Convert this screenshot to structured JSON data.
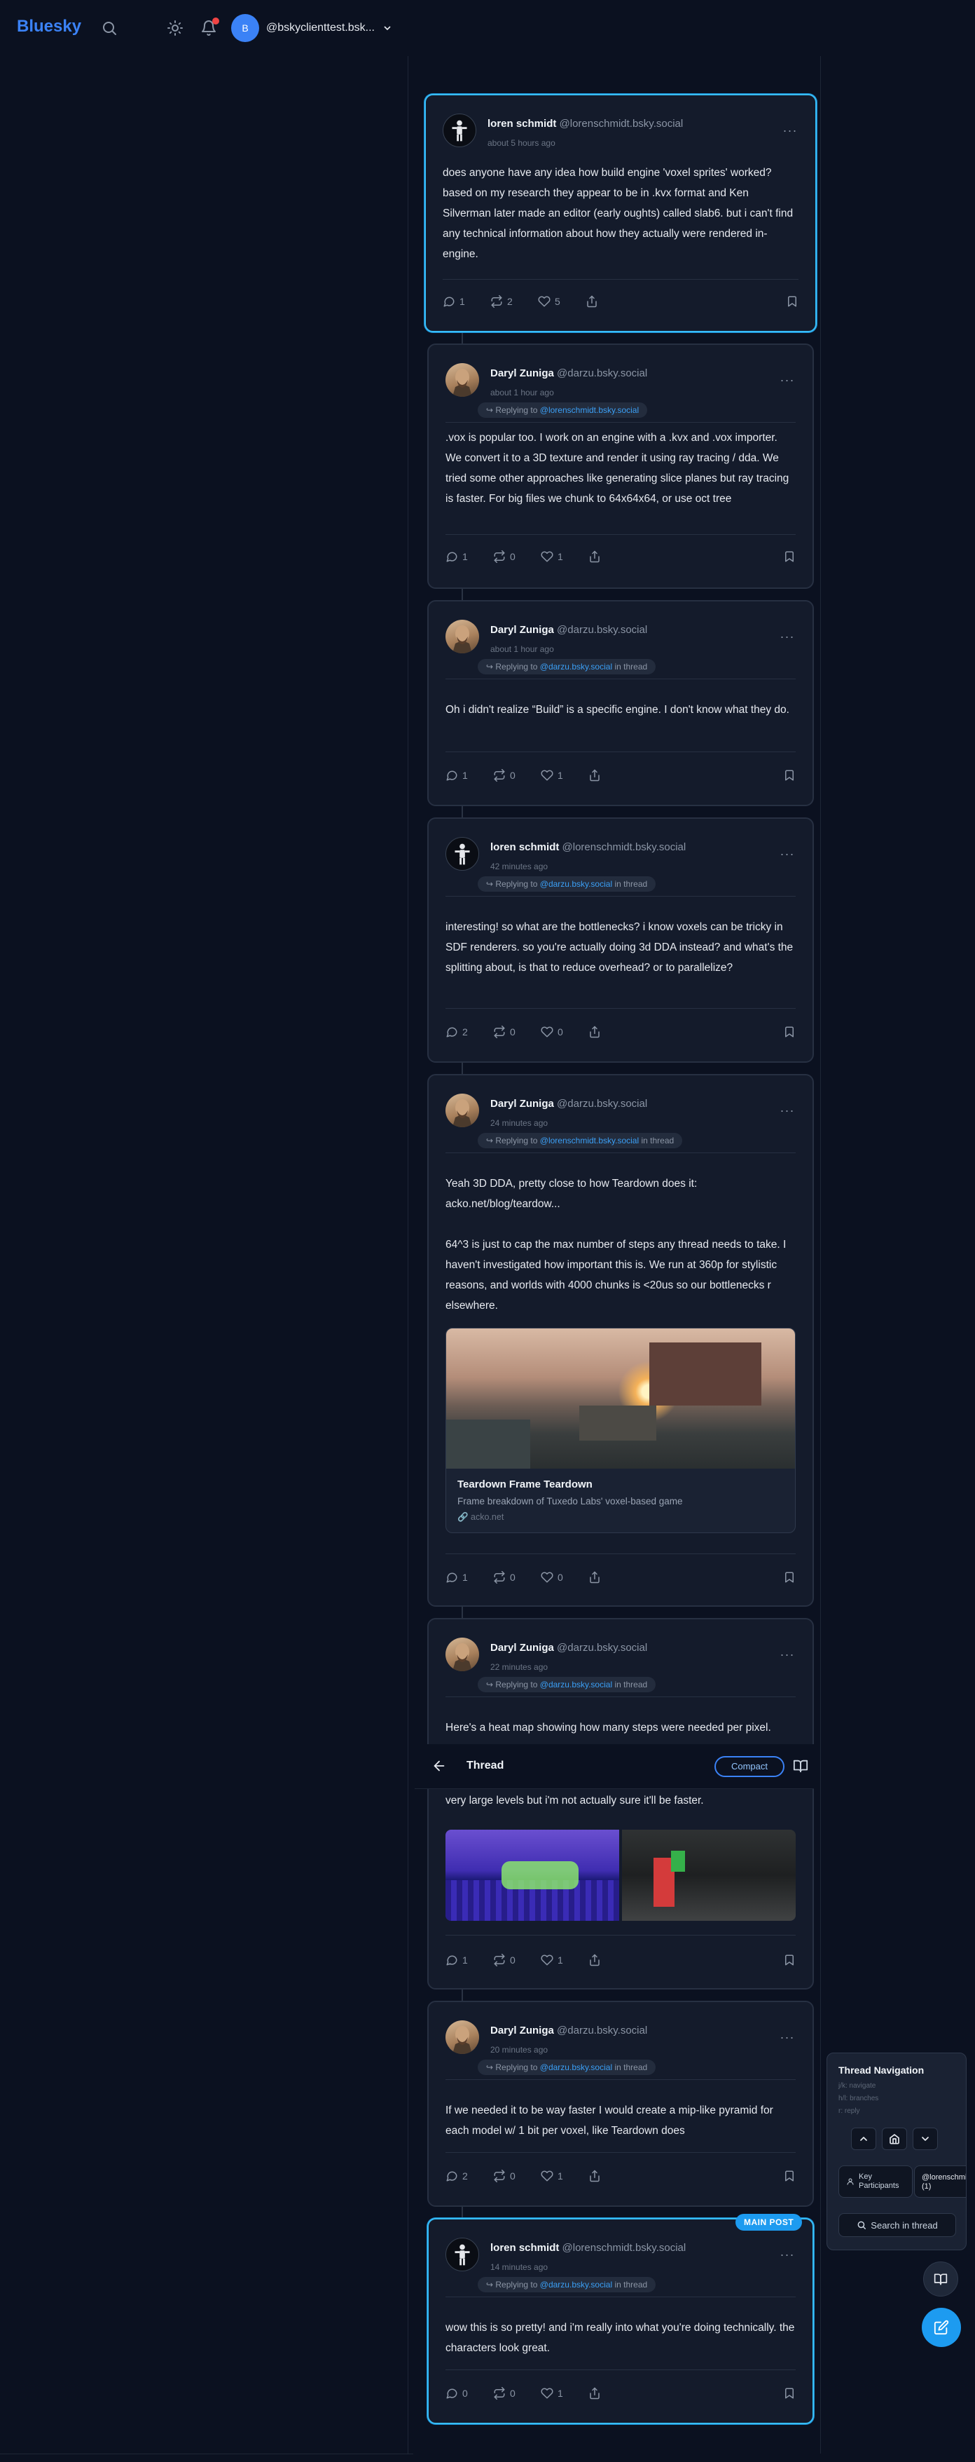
{
  "header": {
    "logo": "Bluesky",
    "account_avatar_letter": "B",
    "account_name": "@bskyclienttest.bsk..."
  },
  "thread_bar": {
    "title": "Thread",
    "compact_label": "Compact"
  },
  "posts": [
    {
      "author": "loren schmidt",
      "handle": "@lorenschmidt.bsky.social",
      "time": "about 5 hours ago",
      "body": [
        "does anyone have any idea how build engine 'voxel sprites' worked? based on my research they appear to be in .kvx format and Ken Silverman later made an editor (early oughts) called slab6. but i can't find any technical information about how they actually were rendered in-engine."
      ],
      "replies": "1",
      "reposts": "2",
      "likes": "5"
    },
    {
      "author": "Daryl Zuniga",
      "handle": "@darzu.bsky.social",
      "time": "about 1 hour ago",
      "replying_prefix": "Replying to",
      "replying_to": "@lorenschmidt.bsky.social",
      "replying_suffix": "",
      "body": [
        ".vox is popular too. I work on an engine with a .kvx and .vox importer. We convert it to a 3D texture and render it using ray tracing / dda. We tried some other approaches like generating slice planes but ray tracing is faster. For big files we chunk to 64x64x64, or use oct tree"
      ],
      "replies": "1",
      "reposts": "0",
      "likes": "1"
    },
    {
      "author": "Daryl Zuniga",
      "handle": "@darzu.bsky.social",
      "time": "about 1 hour ago",
      "replying_prefix": "Replying to",
      "replying_to": "@darzu.bsky.social",
      "replying_suffix": "in thread",
      "body": [
        "Oh i didn't realize “Build” is a specific engine. I don't know what they do."
      ],
      "replies": "1",
      "reposts": "0",
      "likes": "1"
    },
    {
      "author": "loren schmidt",
      "handle": "@lorenschmidt.bsky.social",
      "time": "42 minutes ago",
      "replying_prefix": "Replying to",
      "replying_to": "@darzu.bsky.social",
      "replying_suffix": "in thread",
      "body": [
        "interesting! so what are the bottlenecks? i know voxels can be tricky in SDF renderers. so you're actually doing 3d DDA instead? and what's the splitting about, is that to reduce overhead? or to parallelize?"
      ],
      "replies": "2",
      "reposts": "0",
      "likes": "0"
    },
    {
      "author": "Daryl Zuniga",
      "handle": "@darzu.bsky.social",
      "time": "24 minutes ago",
      "replying_prefix": "Replying to",
      "replying_to": "@lorenschmidt.bsky.social",
      "replying_suffix": "in thread",
      "body": [
        "Yeah 3D DDA, pretty close to how Teardown does it: acko.net/blog/teardow...",
        "64^3 is just to cap the max number of steps any thread needs to take. I haven't investigated how important this is. We run at 360p for stylistic reasons, and worlds with 4000 chunks is <20us so our bottlenecks r elsewhere."
      ],
      "embed": {
        "title": "Teardown Frame Teardown",
        "description": "Frame breakdown of Tuxedo Labs' voxel-based game",
        "domain": "acko.net"
      },
      "replies": "1",
      "reposts": "0",
      "likes": "0"
    },
    {
      "author": "Daryl Zuniga",
      "handle": "@darzu.bsky.social",
      "time": "22 minutes ago",
      "replying_prefix": "Replying to",
      "replying_to": "@darzu.bsky.social",
      "replying_suffix": "in thread",
      "body": [
        "Here's a heat map showing how many steps were needed per pixel.",
        "very large levels but i'm not actually sure it'll be faster."
      ],
      "replies": "1",
      "reposts": "0",
      "likes": "1"
    },
    {
      "author": "Daryl Zuniga",
      "handle": "@darzu.bsky.social",
      "time": "20 minutes ago",
      "replying_prefix": "Replying to",
      "replying_to": "@darzu.bsky.social",
      "replying_suffix": "in thread",
      "body": [
        "If we needed it to be way faster I would create a mip-like pyramid for each model w/ 1 bit per voxel, like Teardown does"
      ],
      "replies": "2",
      "reposts": "0",
      "likes": "1"
    },
    {
      "author": "loren schmidt",
      "handle": "@lorenschmidt.bsky.social",
      "time": "14 minutes ago",
      "replying_prefix": "Replying to",
      "replying_to": "@darzu.bsky.social",
      "replying_suffix": "in thread",
      "body": [
        "wow this is so pretty! and i'm really into what you're doing technically. the characters look great."
      ],
      "replies": "0",
      "reposts": "0",
      "likes": "1",
      "badge": "MAIN POST"
    }
  ],
  "nav_panel": {
    "title": "Thread Navigation",
    "hint1": "j/k: navigate",
    "hint2": "h/l: branches",
    "hint3": "r: reply",
    "key_participants_line1": "Key",
    "key_participants_line2": "Participants",
    "participant_line1": "@lorenschmidt",
    "participant_line2": "(1)",
    "search_label": "Search in thread"
  },
  "colors": {
    "accent": "#1d9bf0",
    "background": "#0b1120",
    "card": "#141b2b"
  }
}
